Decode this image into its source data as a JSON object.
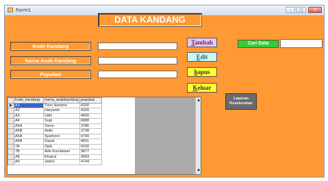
{
  "window": {
    "title": "Form1",
    "controls": [
      "–",
      "□",
      "✕"
    ]
  },
  "header": "DATA KANDANG",
  "labels": {
    "kode": "Kode Kandang",
    "nama": "Nama Anak Kandang",
    "populasi": "Populasi"
  },
  "fields": {
    "kode": "",
    "nama": "",
    "populasi": "",
    "cari": ""
  },
  "buttons": {
    "tambah": {
      "first": "T",
      "rest": "ambah"
    },
    "edit": {
      "first": "E",
      "rest": "dit"
    },
    "hapus": {
      "first": "h",
      "rest": "apus"
    },
    "keluar": {
      "first": "K",
      "rest": "eluar"
    },
    "cari": "Cari Data",
    "laporan_line1": "Laporan",
    "laporan_line2": "Keseluruhan"
  },
  "colors": {
    "form_bg": "#ff9933",
    "label_bg": "#ff9933"
  },
  "grid": {
    "columns": [
      "kode_kandang",
      "nama_anakkandang",
      "populasi"
    ],
    "current_row_indicator": "▶",
    "rows": [
      [
        "A1",
        "Tono Hartono",
        "4200"
      ],
      [
        "A2",
        "Haryanto",
        "4320"
      ],
      [
        "A3",
        "Udin",
        "4800"
      ],
      [
        "A4",
        "Sugi",
        "6888"
      ],
      [
        "A5A",
        "Tarno",
        "3786"
      ],
      [
        "A5B",
        "Anlin",
        "3738"
      ],
      [
        "A6A",
        "Syahroni",
        "4700"
      ],
      [
        "A6B",
        "Dayat",
        "4551"
      ],
      [
        "7A",
        "Opik",
        "4100"
      ],
      [
        "7B",
        "Ade Kurniawan",
        "3877"
      ],
      [
        "A8",
        "Khairul",
        "3683"
      ],
      [
        "A9",
        "Jamin",
        "4744"
      ]
    ]
  }
}
